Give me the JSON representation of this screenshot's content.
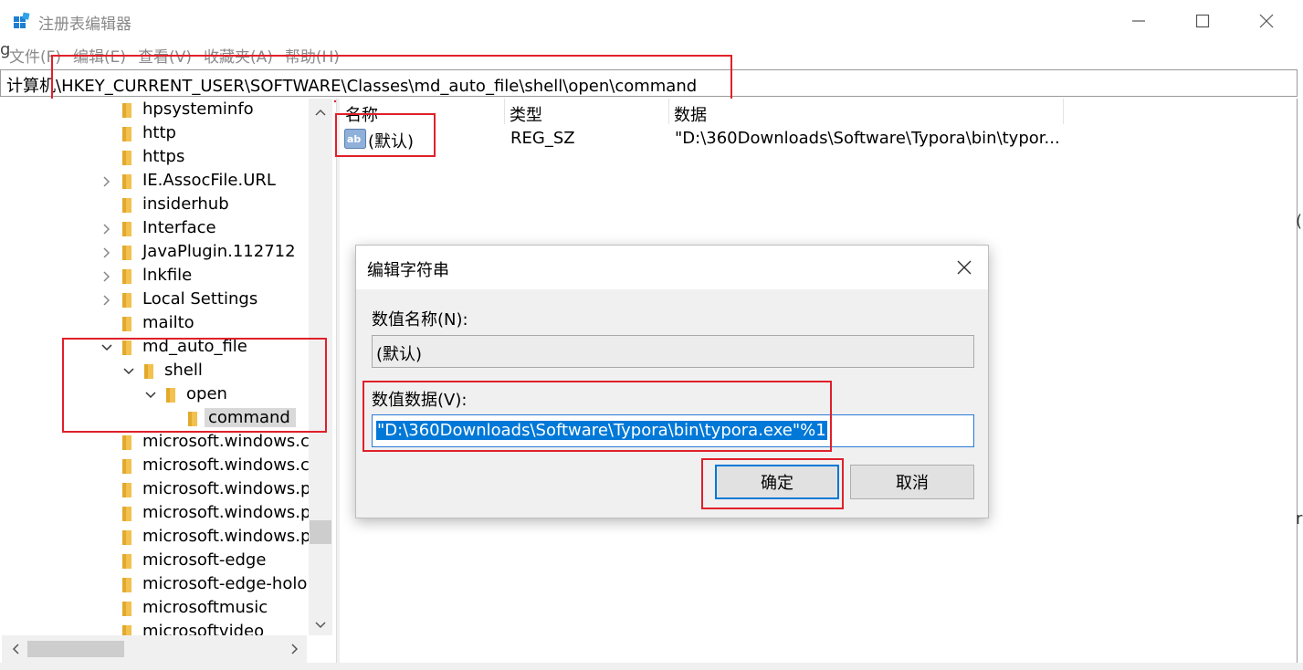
{
  "window": {
    "title": "注册表编辑器",
    "icon": "registry-editor-icon"
  },
  "menubar": {
    "items": [
      "文件(F)",
      "编辑(E)",
      "查看(V)",
      "收藏夹(A)",
      "帮助(H)"
    ]
  },
  "address": {
    "path": "计算机\\HKEY_CURRENT_USER\\SOFTWARE\\Classes\\md_auto_file\\shell\\open\\command"
  },
  "tree": {
    "items": [
      {
        "label": "hpsysteminfo"
      },
      {
        "label": "http"
      },
      {
        "label": "https"
      },
      {
        "label": "IE.AssocFile.URL"
      },
      {
        "label": "insiderhub"
      },
      {
        "label": "Interface"
      },
      {
        "label": "JavaPlugin.112712"
      },
      {
        "label": "lnkfile"
      },
      {
        "label": "Local Settings"
      },
      {
        "label": "mailto"
      },
      {
        "label": "md_auto_file"
      },
      {
        "label": "shell"
      },
      {
        "label": "open"
      },
      {
        "label": "command"
      },
      {
        "label": "microsoft.windows.ca"
      },
      {
        "label": "microsoft.windows.ca"
      },
      {
        "label": "microsoft.windows.pl"
      },
      {
        "label": "microsoft.windows.pl"
      },
      {
        "label": "microsoft.windows.pl"
      },
      {
        "label": "microsoft-edge"
      },
      {
        "label": "microsoft-edge-holo"
      },
      {
        "label": "microsoftmusic"
      },
      {
        "label": "microsoftvideo"
      }
    ]
  },
  "list": {
    "columns": [
      "名称",
      "类型",
      "数据"
    ],
    "rows": [
      {
        "name": "(默认)",
        "type": "REG_SZ",
        "data": "\"D:\\360Downloads\\Software\\Typora\\bin\\typor..."
      }
    ]
  },
  "dialog": {
    "title": "编辑字符串",
    "name_label": "数值名称(N):",
    "name_value": "(默认)",
    "data_label": "数值数据(V):",
    "data_value": "\"D:\\360Downloads\\Software\\Typora\\bin\\typora.exe\"%1",
    "ok_label": "确定",
    "cancel_label": "取消"
  },
  "edge_glyphs": {
    "left_char": "g",
    "right_paren": "(",
    "right_char": "r"
  },
  "colors": {
    "annotation_red": "#e0202a",
    "selection_blue": "#0078d7",
    "folder_yellow": "#f2c14e"
  }
}
